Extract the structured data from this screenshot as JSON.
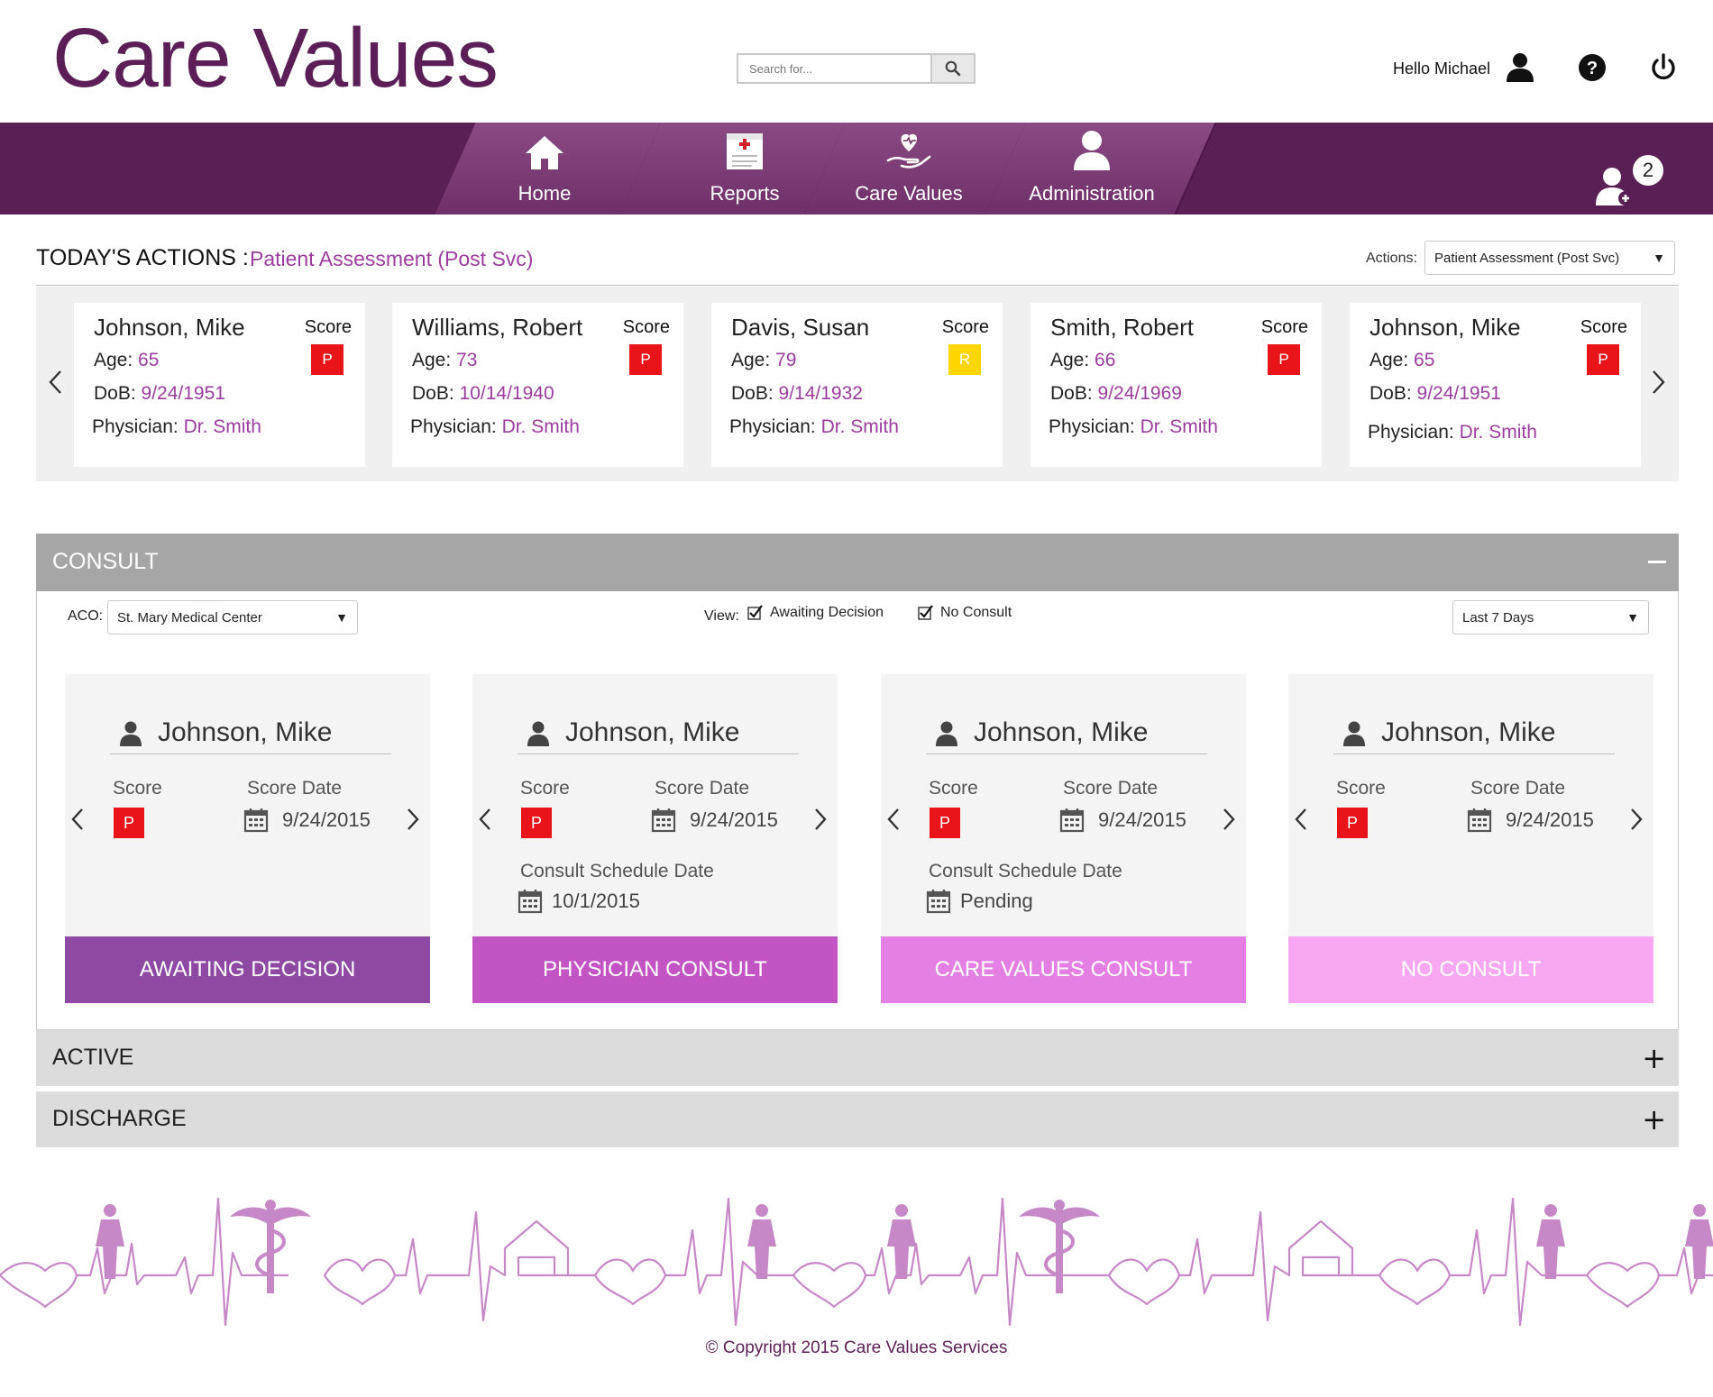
{
  "header": {
    "logo": "Care Values",
    "search_placeholder": "Search for...",
    "greeting": "Hello Michael"
  },
  "nav": {
    "tabs": [
      {
        "label": "Home",
        "icon": "home-icon"
      },
      {
        "label": "Reports",
        "icon": "clipboard-icon"
      },
      {
        "label": "Care Values",
        "icon": "heart-hand-icon"
      },
      {
        "label": "Administration",
        "icon": "user-icon"
      }
    ],
    "notification_count": "2"
  },
  "todays_actions": {
    "title": "TODAY'S ACTIONS :",
    "subtitle": "Patient Assessment (Post Svc)",
    "actions_label": "Actions:",
    "actions_selected": "Patient Assessment (Post Svc)"
  },
  "patients": [
    {
      "name": "Johnson, Mike",
      "score_label": "Score",
      "score": "P",
      "score_color": "#e8141a",
      "age_label": "Age:",
      "age": "65",
      "dob_label": "DoB:",
      "dob": "9/24/1951",
      "physician_label": "Physician:",
      "physician": "Dr. Smith"
    },
    {
      "name": "Williams, Robert",
      "score_label": "Score",
      "score": "P",
      "score_color": "#e8141a",
      "age_label": "Age:",
      "age": "73",
      "dob_label": "DoB:",
      "dob": "10/14/1940",
      "physician_label": "Physician:",
      "physician": "Dr. Smith"
    },
    {
      "name": "Davis, Susan",
      "score_label": "Score",
      "score": "R",
      "score_color": "#ffd600",
      "age_label": "Age:",
      "age": "79",
      "dob_label": "DoB:",
      "dob": "9/14/1932",
      "physician_label": "Physician:",
      "physician": "Dr. Smith"
    },
    {
      "name": "Smith, Robert",
      "score_label": "Score",
      "score": "P",
      "score_color": "#e8141a",
      "age_label": "Age:",
      "age": "66",
      "dob_label": "DoB:",
      "dob": "9/24/1969",
      "physician_label": "Physician:",
      "physician": "Dr. Smith"
    },
    {
      "name": "Johnson, Mike",
      "score_label": "Score",
      "score": "P",
      "score_color": "#e8141a",
      "age_label": "Age:",
      "age": "65",
      "dob_label": "DoB:",
      "dob": "9/24/1951",
      "physician_label": "Physician:",
      "physician": "Dr. Smith"
    }
  ],
  "consult": {
    "title": "CONSULT",
    "aco_label": "ACO:",
    "aco_selected": "St. Mary Medical Center",
    "view_label": "View:",
    "view_options": [
      {
        "label": "Awaiting Decision",
        "checked": true
      },
      {
        "label": "No Consult",
        "checked": true
      }
    ],
    "range_selected": "Last 7 Days",
    "cards": [
      {
        "name": "Johnson, Mike",
        "score_label": "Score",
        "score": "P",
        "score_date_label": "Score Date",
        "score_date": "9/24/2015",
        "schedule_label": "",
        "schedule_value": "",
        "status": "AWAITING DECISION",
        "status_color": "#8e4aa3"
      },
      {
        "name": "Johnson, Mike",
        "score_label": "Score",
        "score": "P",
        "score_date_label": "Score Date",
        "score_date": "9/24/2015",
        "schedule_label": "Consult Schedule Date",
        "schedule_value": "10/1/2015",
        "status": "PHYSICIAN CONSULT",
        "status_color": "#c254c4"
      },
      {
        "name": "Johnson, Mike",
        "score_label": "Score",
        "score": "P",
        "score_date_label": "Score Date",
        "score_date": "9/24/2015",
        "schedule_label": "Consult Schedule Date",
        "schedule_value": "Pending",
        "status": "CARE VALUES CONSULT",
        "status_color": "#e47fe4"
      },
      {
        "name": "Johnson, Mike",
        "score_label": "Score",
        "score": "P",
        "score_date_label": "Score Date",
        "score_date": "9/24/2015",
        "schedule_label": "",
        "schedule_value": "",
        "status": "NO CONSULT",
        "status_color": "#f8a8f2"
      }
    ]
  },
  "sections": [
    {
      "title": "ACTIVE"
    },
    {
      "title": "DISCHARGE"
    }
  ],
  "footer": {
    "copyright": "© Copyright 2015 Care Values Services"
  },
  "colors": {
    "brand": "#5b1e56",
    "accent": "#9b3d9e",
    "decor": "#c788c7"
  }
}
